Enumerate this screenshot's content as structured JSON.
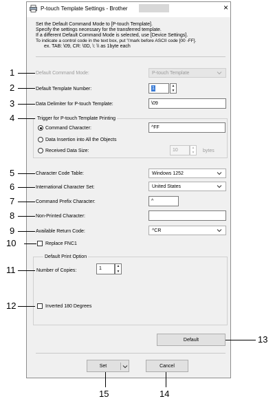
{
  "window": {
    "title": "P-touch Template Settings - Brother",
    "close_label": "×"
  },
  "intro": {
    "line1": "Set the Default Command Mode to [P-touch Template].",
    "line2": "Specify the settings necessary for the transferred template.",
    "line3": "If a different Default Command Mode is selected, use [Device Settings].",
    "line4": "To indicate a control code in the text box, put '\\'mark before ASCII code [00 -FF].",
    "line5": "ex. TAB: \\09,  CR: \\0D,  \\: \\\\  as 1byte each"
  },
  "fields": {
    "default_command_mode": {
      "label": "Default Command Mode:",
      "value": "P-touch Template",
      "enabled": false
    },
    "default_template_number": {
      "label": "Default Template Number:",
      "value": "1"
    },
    "data_delimiter": {
      "label": "Data Delimiter for P-touch Template:",
      "value": "\\09"
    },
    "trigger_group": {
      "legend": "Trigger for P-touch Template Printing",
      "command_character": {
        "label": "Command Character:",
        "value": "^FF",
        "selected": true
      },
      "data_insertion": {
        "label": "Data Insertion into All the Objects",
        "selected": false
      },
      "received_data_size": {
        "label": "Received Data Size:",
        "value": "10",
        "unit": "bytes",
        "selected": false
      }
    },
    "character_code_table": {
      "label": "Character Code Table:",
      "value": "Windows 1252"
    },
    "international_character_set": {
      "label": "International Character Set:",
      "value": "United States"
    },
    "command_prefix_character": {
      "label": "Command Prefix Character:",
      "value": "^"
    },
    "non_printed_character": {
      "label": "Non-Printed Character:",
      "value": ""
    },
    "available_return_code": {
      "label": "Available Return Code:",
      "value": "^CR"
    },
    "replace_fnc1": {
      "label": "Replace FNC1",
      "checked": false
    },
    "print_option_group": {
      "legend": "Default Print Option",
      "number_of_copies": {
        "label": "Number of Copies:",
        "value": "1"
      },
      "inverted_180": {
        "label": "Inverted 180 Degrees",
        "checked": false
      }
    }
  },
  "buttons": {
    "default_label": "Default",
    "set_label": "Set",
    "cancel_label": "Cancel"
  },
  "callouts": [
    "1",
    "2",
    "3",
    "4",
    "5",
    "6",
    "7",
    "8",
    "9",
    "10",
    "11",
    "12",
    "13",
    "14",
    "15"
  ]
}
